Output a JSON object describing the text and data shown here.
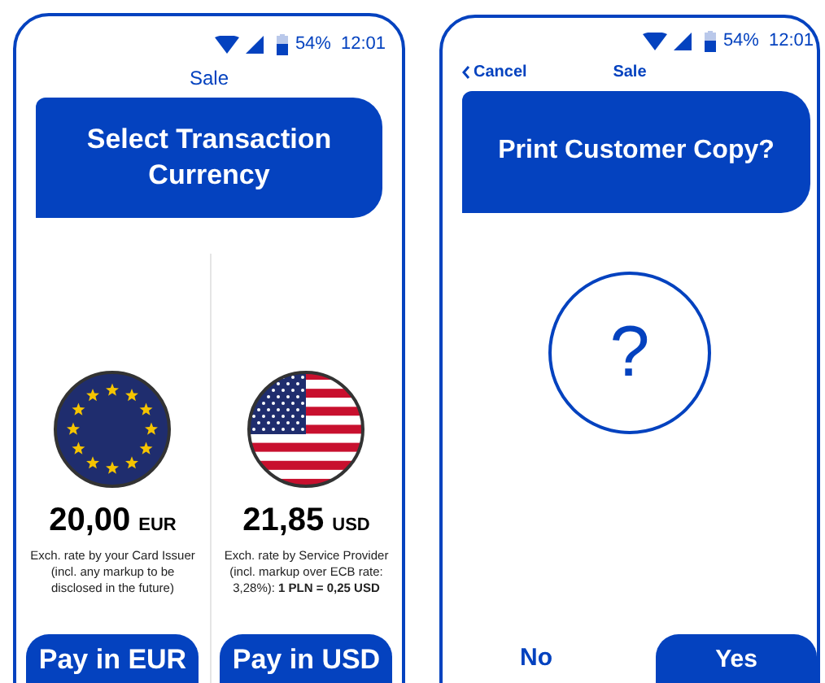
{
  "screens": [
    {
      "status_bar": {
        "battery": "54%",
        "time": "12:01"
      },
      "header": {
        "title": "Sale"
      },
      "banner": {
        "title": "Select Transaction Currency"
      },
      "options": [
        {
          "kind": "eu",
          "amount": "20,00",
          "currency": "EUR",
          "description": "Exch. rate by your Card Issuer (incl. any markup to be disclosed in the future)",
          "button": "Pay in EUR"
        },
        {
          "kind": "us",
          "amount": "21,85",
          "currency": "USD",
          "description": "Exch. rate by Service Provider (incl. markup over ECB rate: 3,28%):  **1 PLN = 0,25 USD**",
          "button": "Pay in USD"
        }
      ]
    },
    {
      "status_bar": {
        "battery": "54%",
        "time": "12:01"
      },
      "header": {
        "back": "Cancel",
        "title": "Sale"
      },
      "banner": {
        "title": "Print Customer Copy?"
      },
      "symbol": "?",
      "buttons": [
        {
          "label": "No",
          "kind": "text"
        },
        {
          "label": "Yes",
          "kind": "filled"
        }
      ]
    }
  ]
}
